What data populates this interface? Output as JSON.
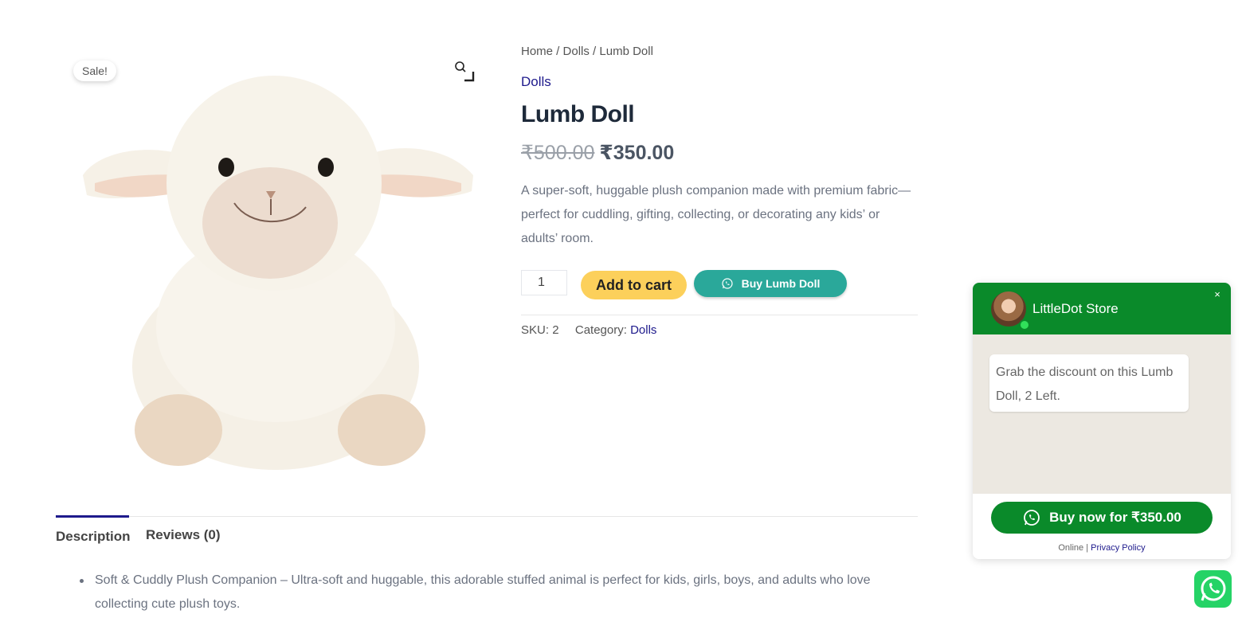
{
  "gallery": {
    "sale_badge": "Sale!"
  },
  "breadcrumb": {
    "home": "Home",
    "sep1": " / ",
    "category": "Dolls",
    "sep2": " / ",
    "current": "Lumb Doll"
  },
  "product": {
    "category": "Dolls",
    "title": "Lumb Doll",
    "old_price": "₹500.00",
    "price": "₹350.00",
    "description": "A super-soft, huggable plush companion made with premium fabric—perfect for cuddling, gifting, collecting, or decorating any kids’ or adults’ room.",
    "quantity": "1",
    "add_to_cart": "Add to cart",
    "buy_whatsapp": "Buy Lumb Doll",
    "sku_label": "SKU:",
    "sku_value": "2",
    "category_label": "Category:",
    "category_value": "Dolls"
  },
  "tabs": {
    "description": "Description",
    "reviews": "Reviews (0)"
  },
  "description_bullets": [
    "Soft & Cuddly Plush Companion – Ultra-soft and huggable, this adorable stuffed animal is perfect for kids, girls, boys, and adults who love collecting cute plush toys."
  ],
  "chat": {
    "store_name": "LittleDot Store",
    "close": "×",
    "message": "Grab the discount on this Lumb Doll, 2 Left.",
    "buy_now": "Buy now for ₹350.00",
    "status": "Online",
    "separator": "|",
    "privacy": "Privacy Policy",
    "brand_color": "#0a8a2a"
  },
  "icons": {
    "zoom": "magnifier-icon",
    "whatsapp": "whatsapp-icon",
    "close": "close-icon"
  },
  "colors": {
    "accent_link": "#1e1a8c",
    "add_to_cart_bg": "#fcd05b",
    "buy_whatsapp_bg": "#2aa89a",
    "whatsapp_float_bg": "#25d366"
  }
}
